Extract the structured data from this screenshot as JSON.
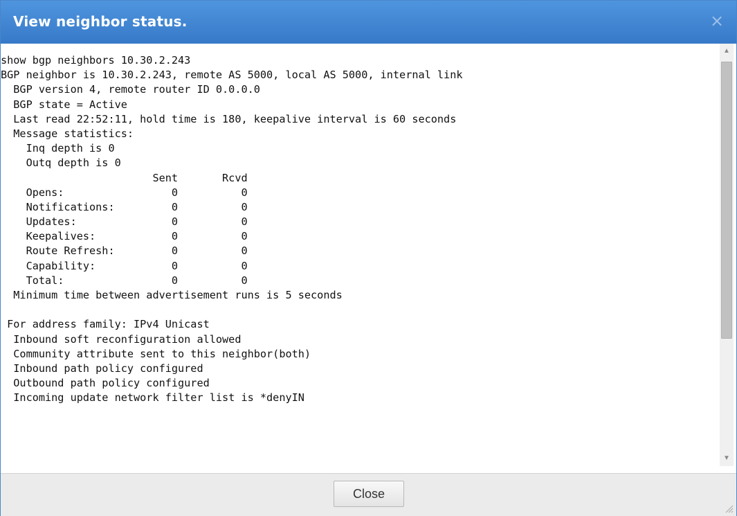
{
  "dialog": {
    "title": "View neighbor status.",
    "close_icon": "close-icon",
    "close_glyph": "×"
  },
  "console": {
    "lines": [
      "show bgp neighbors 10.30.2.243",
      "BGP neighbor is 10.30.2.243, remote AS 5000, local AS 5000, internal link",
      "  BGP version 4, remote router ID 0.0.0.0",
      "  BGP state = Active",
      "  Last read 22:52:11, hold time is 180, keepalive interval is 60 seconds",
      "  Message statistics:",
      "    Inq depth is 0",
      "    Outq depth is 0",
      "                        Sent       Rcvd",
      "    Opens:                 0          0",
      "    Notifications:         0          0",
      "    Updates:               0          0",
      "    Keepalives:            0          0",
      "    Route Refresh:         0          0",
      "    Capability:            0          0",
      "    Total:                 0          0",
      "  Minimum time between advertisement runs is 5 seconds",
      "",
      " For address family: IPv4 Unicast",
      "  Inbound soft reconfiguration allowed",
      "  Community attribute sent to this neighbor(both)",
      "  Inbound path policy configured",
      "  Outbound path policy configured",
      "  Incoming update network filter list is *denyIN"
    ]
  },
  "scrollbar": {
    "up_glyph": "▲",
    "down_glyph": "▼",
    "position_fraction": 0
  },
  "footer": {
    "close_label": "Close"
  }
}
